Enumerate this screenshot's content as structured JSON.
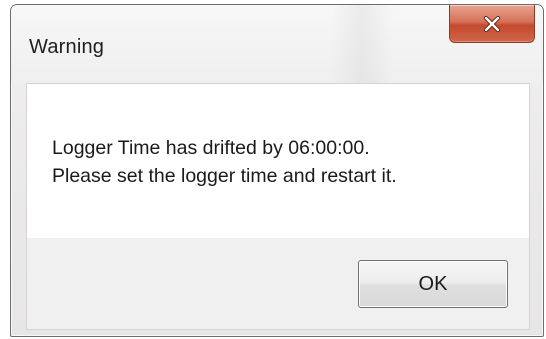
{
  "window": {
    "title": "Warning",
    "close_icon": "close-x-icon",
    "close_button_color": "#c44a2c"
  },
  "message": {
    "line1": "Logger Time has drifted by 06:00:00.",
    "line2": "Please set the logger time and restart it."
  },
  "buttons": {
    "ok_label": "OK"
  }
}
